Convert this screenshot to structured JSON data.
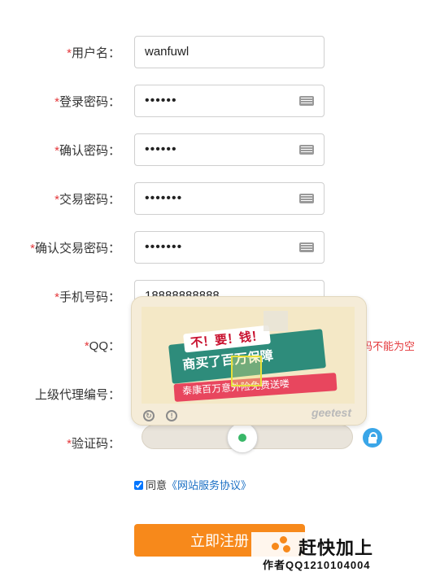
{
  "form": {
    "required_mark": "*",
    "username": {
      "label": "用户名：",
      "value": "wanfuwl"
    },
    "login_password": {
      "label": "登录密码：",
      "value": "••••••"
    },
    "confirm_password": {
      "label": "确认密码：",
      "value": "••••••"
    },
    "trade_password": {
      "label": "交易密码：",
      "value": "•••••••"
    },
    "confirm_trade_password": {
      "label": "确认交易密码：",
      "value": "•••••••"
    },
    "phone": {
      "label": "手机号码：",
      "value": "18888888888"
    },
    "qq": {
      "label": "QQ：",
      "error": "码不能为空"
    },
    "agent_code": {
      "label": "上级代理编号："
    },
    "captcha": {
      "label": "验证码："
    }
  },
  "captcha_popup": {
    "headline": "不！要！钱！",
    "subline": "商买了百万保障",
    "ribbon": "泰康百万意外险免费送喽",
    "brand": "geetest",
    "refresh_icon": "refresh-icon",
    "info_icon": "info-icon"
  },
  "agreement": {
    "prefix": "同意",
    "link": "《网站服务协议》",
    "checked": true
  },
  "submit_label": "立即注册",
  "watermark": {
    "title": "赶快加上",
    "subtitle": "作者QQ1210104004"
  }
}
